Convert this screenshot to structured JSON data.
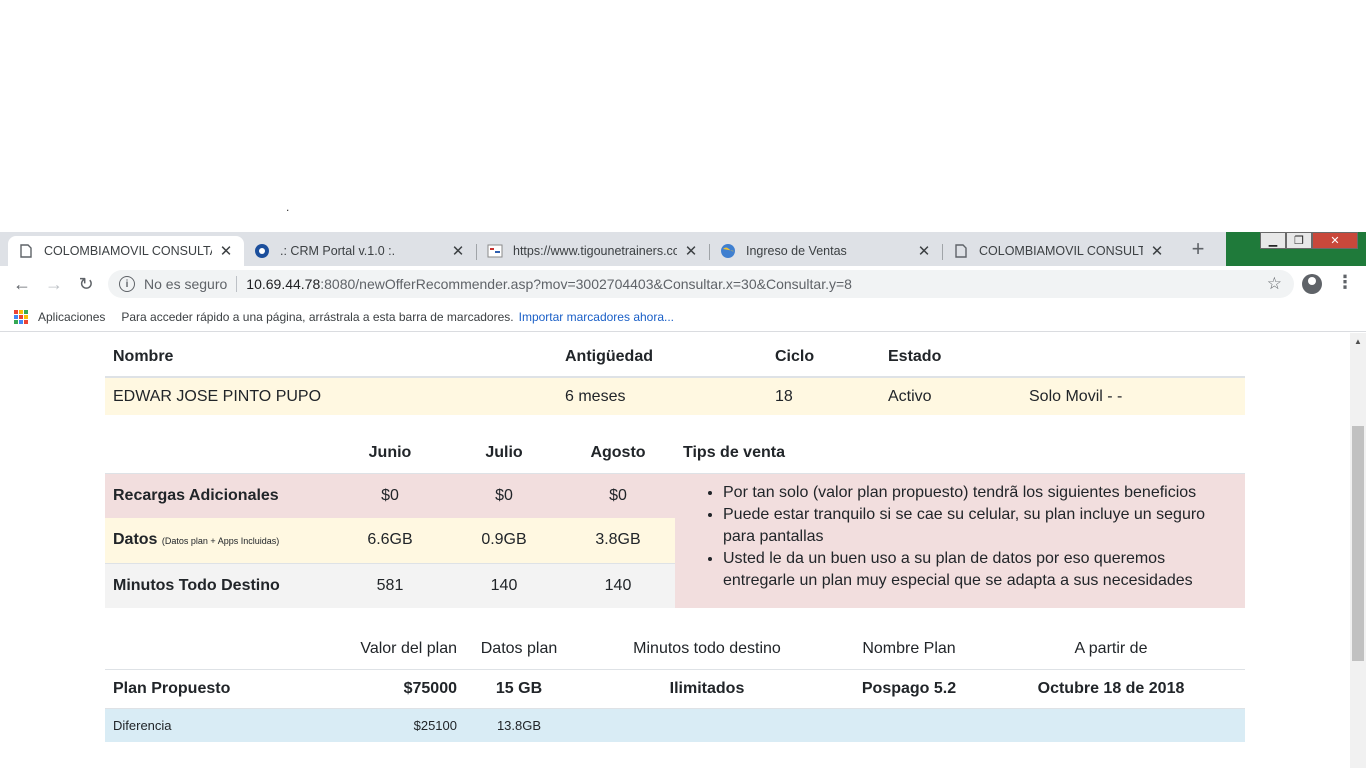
{
  "browser": {
    "tabs": [
      {
        "title": "COLOMBIAMOVIL CONSULTA IN",
        "active": true,
        "icon": "page-icon"
      },
      {
        "title": ".: CRM Portal v.1.0 :.",
        "active": false,
        "icon": "tigo-icon"
      },
      {
        "title": "https://www.tigounetrainers.con",
        "active": false,
        "icon": "site-icon"
      },
      {
        "title": "Ingreso de Ventas",
        "active": false,
        "icon": "globe-icon"
      },
      {
        "title": "COLOMBIAMOVIL CONSULTA IN",
        "active": false,
        "icon": "page-icon"
      }
    ],
    "tab_close_glyph": "✕",
    "new_tab_glyph": "+",
    "security_label": "No es seguro",
    "url_host": "10.69.44.78",
    "url_rest": ":8080/newOfferRecommender.asp?mov=3002704403&Consultar.x=30&Consultar.y=8",
    "bookmarks": {
      "apps_label": "Aplicaciones",
      "hint": "Para acceder rápido a una página, arrástrala a esta barra de marcadores.",
      "import_link": "Importar marcadores ahora..."
    }
  },
  "customer": {
    "headers": [
      "Nombre",
      "Antigüedad",
      "Ciclo",
      "Estado",
      ""
    ],
    "values": [
      "EDWAR JOSE PINTO PUPO",
      "6 meses",
      "18",
      "Activo",
      "Solo Movil - -"
    ]
  },
  "usage": {
    "months": [
      "Junio",
      "Julio",
      "Agosto"
    ],
    "tips_header": "Tips de venta",
    "rows": [
      {
        "label": "Recargas Adicionales",
        "note": "",
        "values": [
          "$0",
          "$0",
          "$0"
        ]
      },
      {
        "label": "Datos",
        "note": "(Datos plan + Apps Incluidas)",
        "values": [
          "6.6GB",
          "0.9GB",
          "3.8GB"
        ]
      },
      {
        "label": "Minutos Todo Destino",
        "note": "",
        "values": [
          "581",
          "140",
          "140"
        ]
      }
    ],
    "tips": [
      "Por tan solo (valor plan propuesto) tendrã los siguientes beneficios",
      "Puede estar tranquilo si se cae su celular, su plan incluye un seguro para pantallas",
      "Usted le da un buen uso a su plan de datos por eso queremos entregarle un plan muy especial que se adapta a sus necesidades"
    ]
  },
  "plan": {
    "headers": [
      "",
      "Valor del plan",
      "Datos plan",
      "Minutos todo destino",
      "Nombre Plan",
      "A partir de"
    ],
    "proposed": [
      "Plan Propuesto",
      "$75000",
      "15 GB",
      "Ilimitados",
      "Pospago 5.2",
      "Octubre 18 de 2018"
    ],
    "difference": [
      "Diferencia",
      "$25100",
      "13.8GB",
      "",
      "",
      ""
    ]
  },
  "colors": {
    "red_row": "#f2dede",
    "yellow_row": "#fff8e1",
    "blue_row": "#d9ecf5",
    "grey_row": "#f3f3f3",
    "link": "#1a5fc7"
  }
}
